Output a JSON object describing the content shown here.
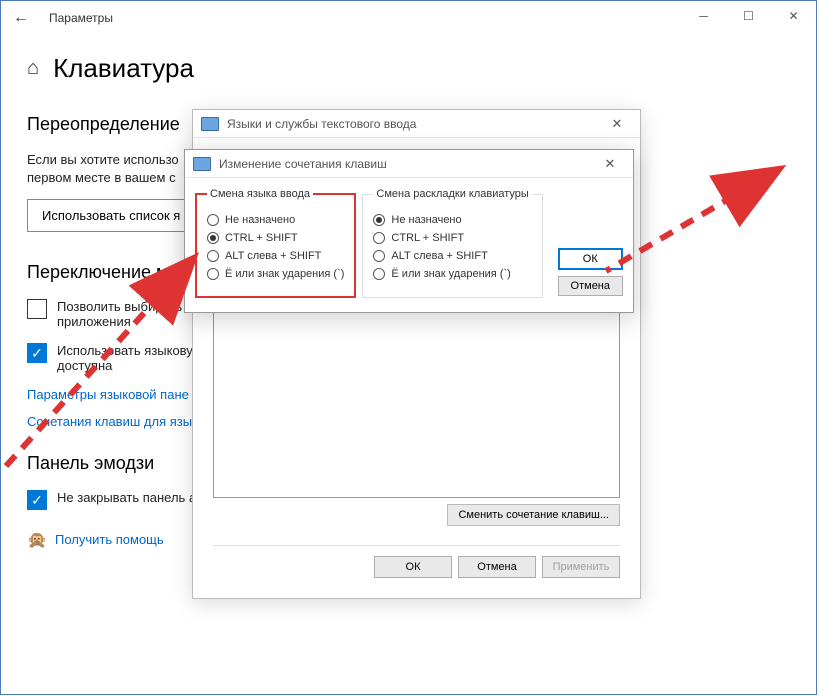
{
  "settings": {
    "app_title": "Параметры",
    "page_title": "Клавиатура",
    "section_override": "Переопределение",
    "override_text_line1": "Если вы хотите использо",
    "override_text_line2": "первом месте в вашем с",
    "btn_use_list": "Использовать список я",
    "section_switching": "Переключение м",
    "cb_allow_choose": "Позволить выбирать м",
    "cb_allow_choose2": "приложения",
    "cb_use_lang": "Использовать языкову",
    "cb_use_lang2": "доступна",
    "link_lang_panel": "Параметры языковой пане",
    "link_hotkeys": "Сочетания клавиш для язы",
    "section_emoji": "Панель эмодзи",
    "cb_emoji": "Не закрывать панель автоматически после ввода эмодзи",
    "link_help": "Получить помощь"
  },
  "dialog1": {
    "title": "Языки и службы текстового ввода",
    "btn_change": "Сменить сочетание клавиш...",
    "btn_ok": "ОК",
    "btn_cancel": "Отмена",
    "btn_apply": "Применить"
  },
  "dialog2": {
    "title": "Изменение сочетания клавиш",
    "group1": "Смена языка ввода",
    "group2": "Смена раскладки клавиатуры",
    "r_not_assigned": "Не назначено",
    "r_ctrl_shift": "CTRL + SHIFT",
    "r_alt_shift": "ALT слева + SHIFT",
    "r_e_accent": "Ё или знак ударения (`)",
    "btn_ok": "ОК",
    "btn_cancel": "Отмена"
  }
}
